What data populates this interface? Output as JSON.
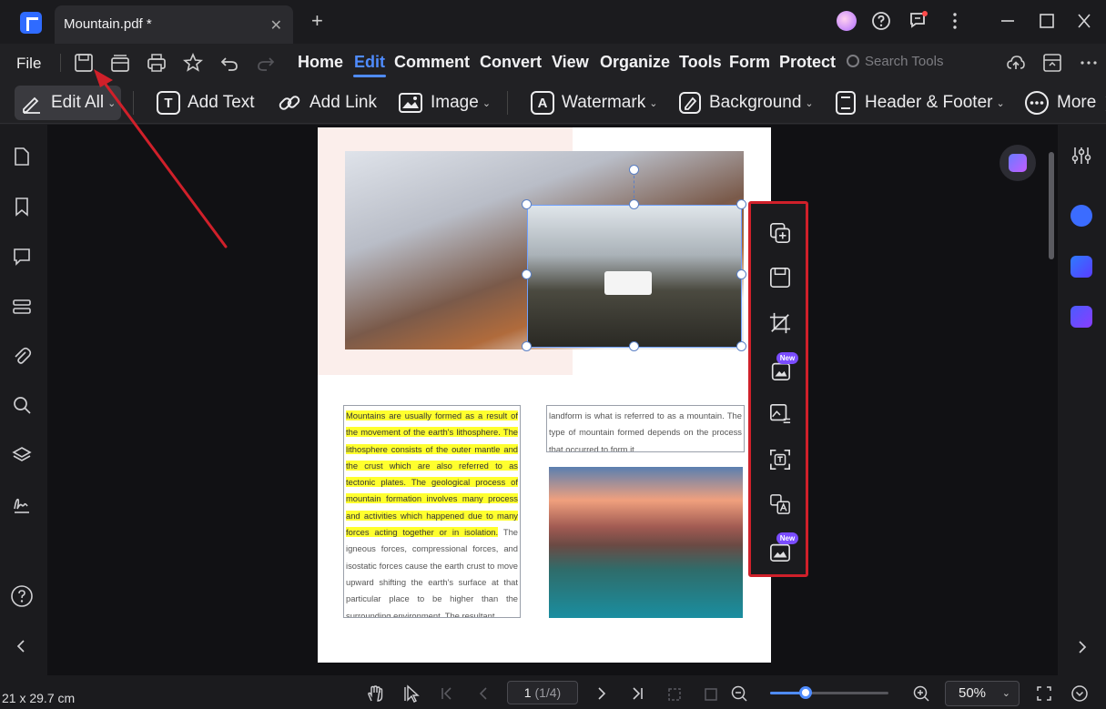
{
  "titlebar": {
    "tab_title": "Mountain.pdf *",
    "close_glyph": "✕",
    "new_tab_glyph": "+",
    "icons": [
      "avatar",
      "help-icon",
      "feedback-icon",
      "more-vertical-icon",
      "minimize-icon",
      "maximize-icon",
      "close-icon"
    ]
  },
  "menubar": {
    "file": "File",
    "items": [
      "Home",
      "Edit",
      "Comment",
      "Convert",
      "View",
      "Organize",
      "Tools",
      "Form",
      "Protect"
    ],
    "active": "Edit",
    "search_placeholder": "Search Tools"
  },
  "toolbar": {
    "edit_all": "Edit All",
    "add_text": "Add Text",
    "add_link": "Add Link",
    "image": "Image",
    "watermark": "Watermark",
    "background": "Background",
    "header_footer": "Header & Footer",
    "more": "More"
  },
  "document": {
    "col1_highlighted": "Mountains are usually formed as a result of the movement of the earth's lithosphere. The lithosphere consists of the outer mantle and the crust which are also referred to as tectonic plates. The geological process of mountain formation involves many process and activities which happened due to many forces acting together or in isolation.",
    "col1_rest": " The igneous forces, compressional forces, and isostatic forces cause the earth crust to move upward shifting the earth's surface at that particular place to be higher than the surrounding environment. The resultant",
    "col2": "landform is what is referred to as a mountain. The type of mountain formed depends on the process that occurred to form it."
  },
  "image_toolbar": {
    "new_badge": "New",
    "icons": [
      "replace-image-icon",
      "save-image-icon",
      "crop-icon",
      "ai-image-icon",
      "image-edit-icon",
      "ocr-text-icon",
      "translate-icon",
      "ai-image-2-icon"
    ]
  },
  "statusbar": {
    "page_size": "21 x 29.7 cm",
    "page_current": "1",
    "page_total": "(1/4)",
    "zoom": "50%",
    "zoom_fraction": 0.3
  },
  "colors": {
    "accent": "#4f8cff",
    "highlight": "#ffff2e",
    "annotation": "#d0202a"
  }
}
